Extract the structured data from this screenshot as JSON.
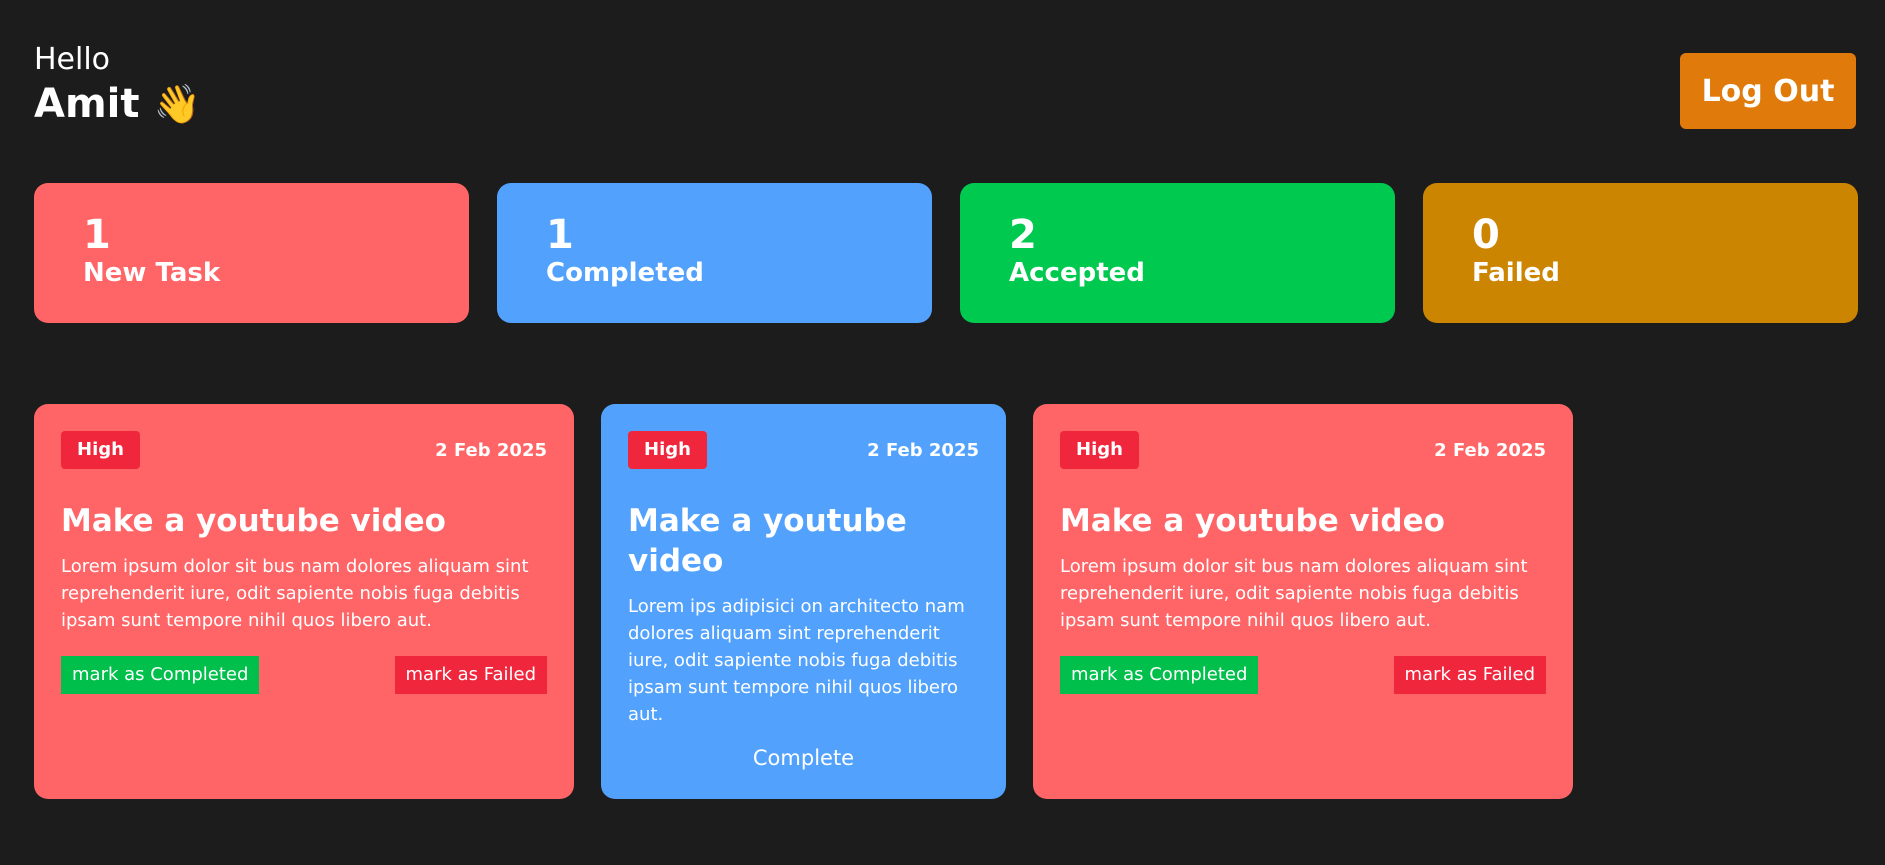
{
  "header": {
    "greeting": "Hello",
    "user_name": "Amit",
    "wave_emoji": "👋",
    "logout_label": "Log Out"
  },
  "stats": [
    {
      "count": "1",
      "label": "New Task",
      "color": "#ff6466"
    },
    {
      "count": "1",
      "label": "Completed",
      "color": "#52a2fd"
    },
    {
      "count": "2",
      "label": "Accepted",
      "color": "#00c950"
    },
    {
      "count": "0",
      "label": "Failed",
      "color": "#cc8500"
    }
  ],
  "tasks": [
    {
      "priority": "High",
      "date": "2 Feb 2025",
      "title": "Make a youtube video",
      "description": "Lorem ipsum dolor sit bus nam dolores aliquam sint reprehenderit iure, odit sapiente nobis fuga debitis ipsam sunt tempore nihil quos libero aut.",
      "complete_label": "mark as Completed",
      "fail_label": "mark as Failed",
      "color": "#ff6466"
    },
    {
      "priority": "High",
      "date": "2 Feb 2025",
      "title": "Make a youtube video",
      "description": "Lorem ips adipisici on architecto nam dolores aliquam sint reprehenderit iure, odit sapiente nobis fuga debitis ipsam sunt tempore nihil quos libero aut.",
      "status": "Complete",
      "color": "#52a2fd"
    },
    {
      "priority": "High",
      "date": "2 Feb 2025",
      "title": "Make a youtube video",
      "description": "Lorem ipsum dolor sit bus nam dolores aliquam sint reprehenderit iure, odit sapiente nobis fuga debitis ipsam sunt tempore nihil quos libero aut.",
      "complete_label": "mark as Completed",
      "fail_label": "mark as Failed",
      "color": "#ff6466"
    }
  ]
}
